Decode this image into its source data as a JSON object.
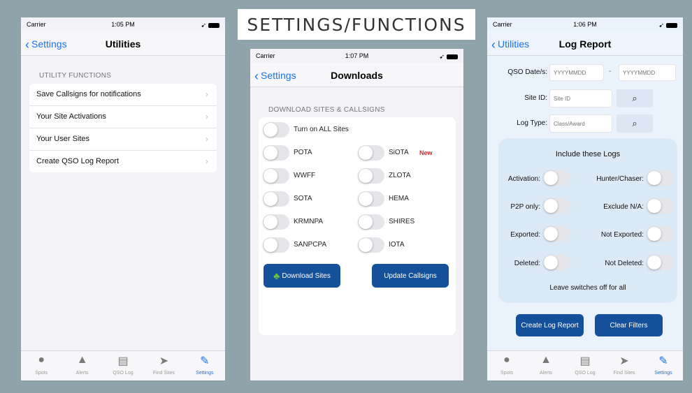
{
  "title": "SETTINGS/FUNCTIONS",
  "status": {
    "carrier": "Carrier",
    "left_time": "1:05 PM",
    "middle_time": "1:07 PM",
    "right_time": "1:06 PM"
  },
  "left": {
    "back_label": "Settings",
    "title": "Utilities",
    "section_header": "UTILITY FUNCTIONS",
    "items": [
      {
        "label": "Save Callsigns for notifications"
      },
      {
        "label": "Your Site Activations"
      },
      {
        "label": "Your User Sites"
      },
      {
        "label": "Create QSO Log Report"
      }
    ]
  },
  "middle": {
    "back_label": "Settings",
    "title": "Downloads",
    "section_header": "DOWNLOAD SITES & CALLSIGNS",
    "all_label": "Turn on ALL Sites",
    "left_sites": [
      "POTA",
      "WWFF",
      "SOTA",
      "KRMNPA",
      "SANPCPA"
    ],
    "right_sites": [
      "SiOTA",
      "ZLOTA",
      "HEMA",
      "SHIRES",
      "IOTA"
    ],
    "new_badge": "New",
    "download_button": "Download Sites",
    "update_button": "Update Callsigns"
  },
  "right": {
    "back_label": "Utilities",
    "title": "Log Report",
    "qso_dates_label": "QSO Date/s:",
    "date_from_placeholder": "YYYYMMDD",
    "date_to_placeholder": "YYYYMMDD",
    "site_id_label": "Site ID:",
    "site_id_placeholder": "Site ID",
    "log_type_label": "Log Type:",
    "log_type_placeholder": "Class/Award",
    "logs_heading": "Include these Logs",
    "toggles_left": [
      "Activation:",
      "P2P only:",
      "Exported:",
      "Deleted:"
    ],
    "toggles_right": [
      "Hunter/Chaser:",
      "Exclude N/A:",
      "Not Exported:",
      "Not Deleted:"
    ],
    "footer_note": "Leave switches off for all",
    "create_button": "Create Log Report",
    "clear_button": "Clear Filters"
  },
  "tabs": [
    "Spots",
    "Alerts",
    "QSO Log",
    "Find Sites",
    "Settings"
  ],
  "colors": {
    "accent": "#1a73e8",
    "button": "#15509a",
    "new_badge": "#e0242b",
    "background": "#8fa3ab"
  }
}
